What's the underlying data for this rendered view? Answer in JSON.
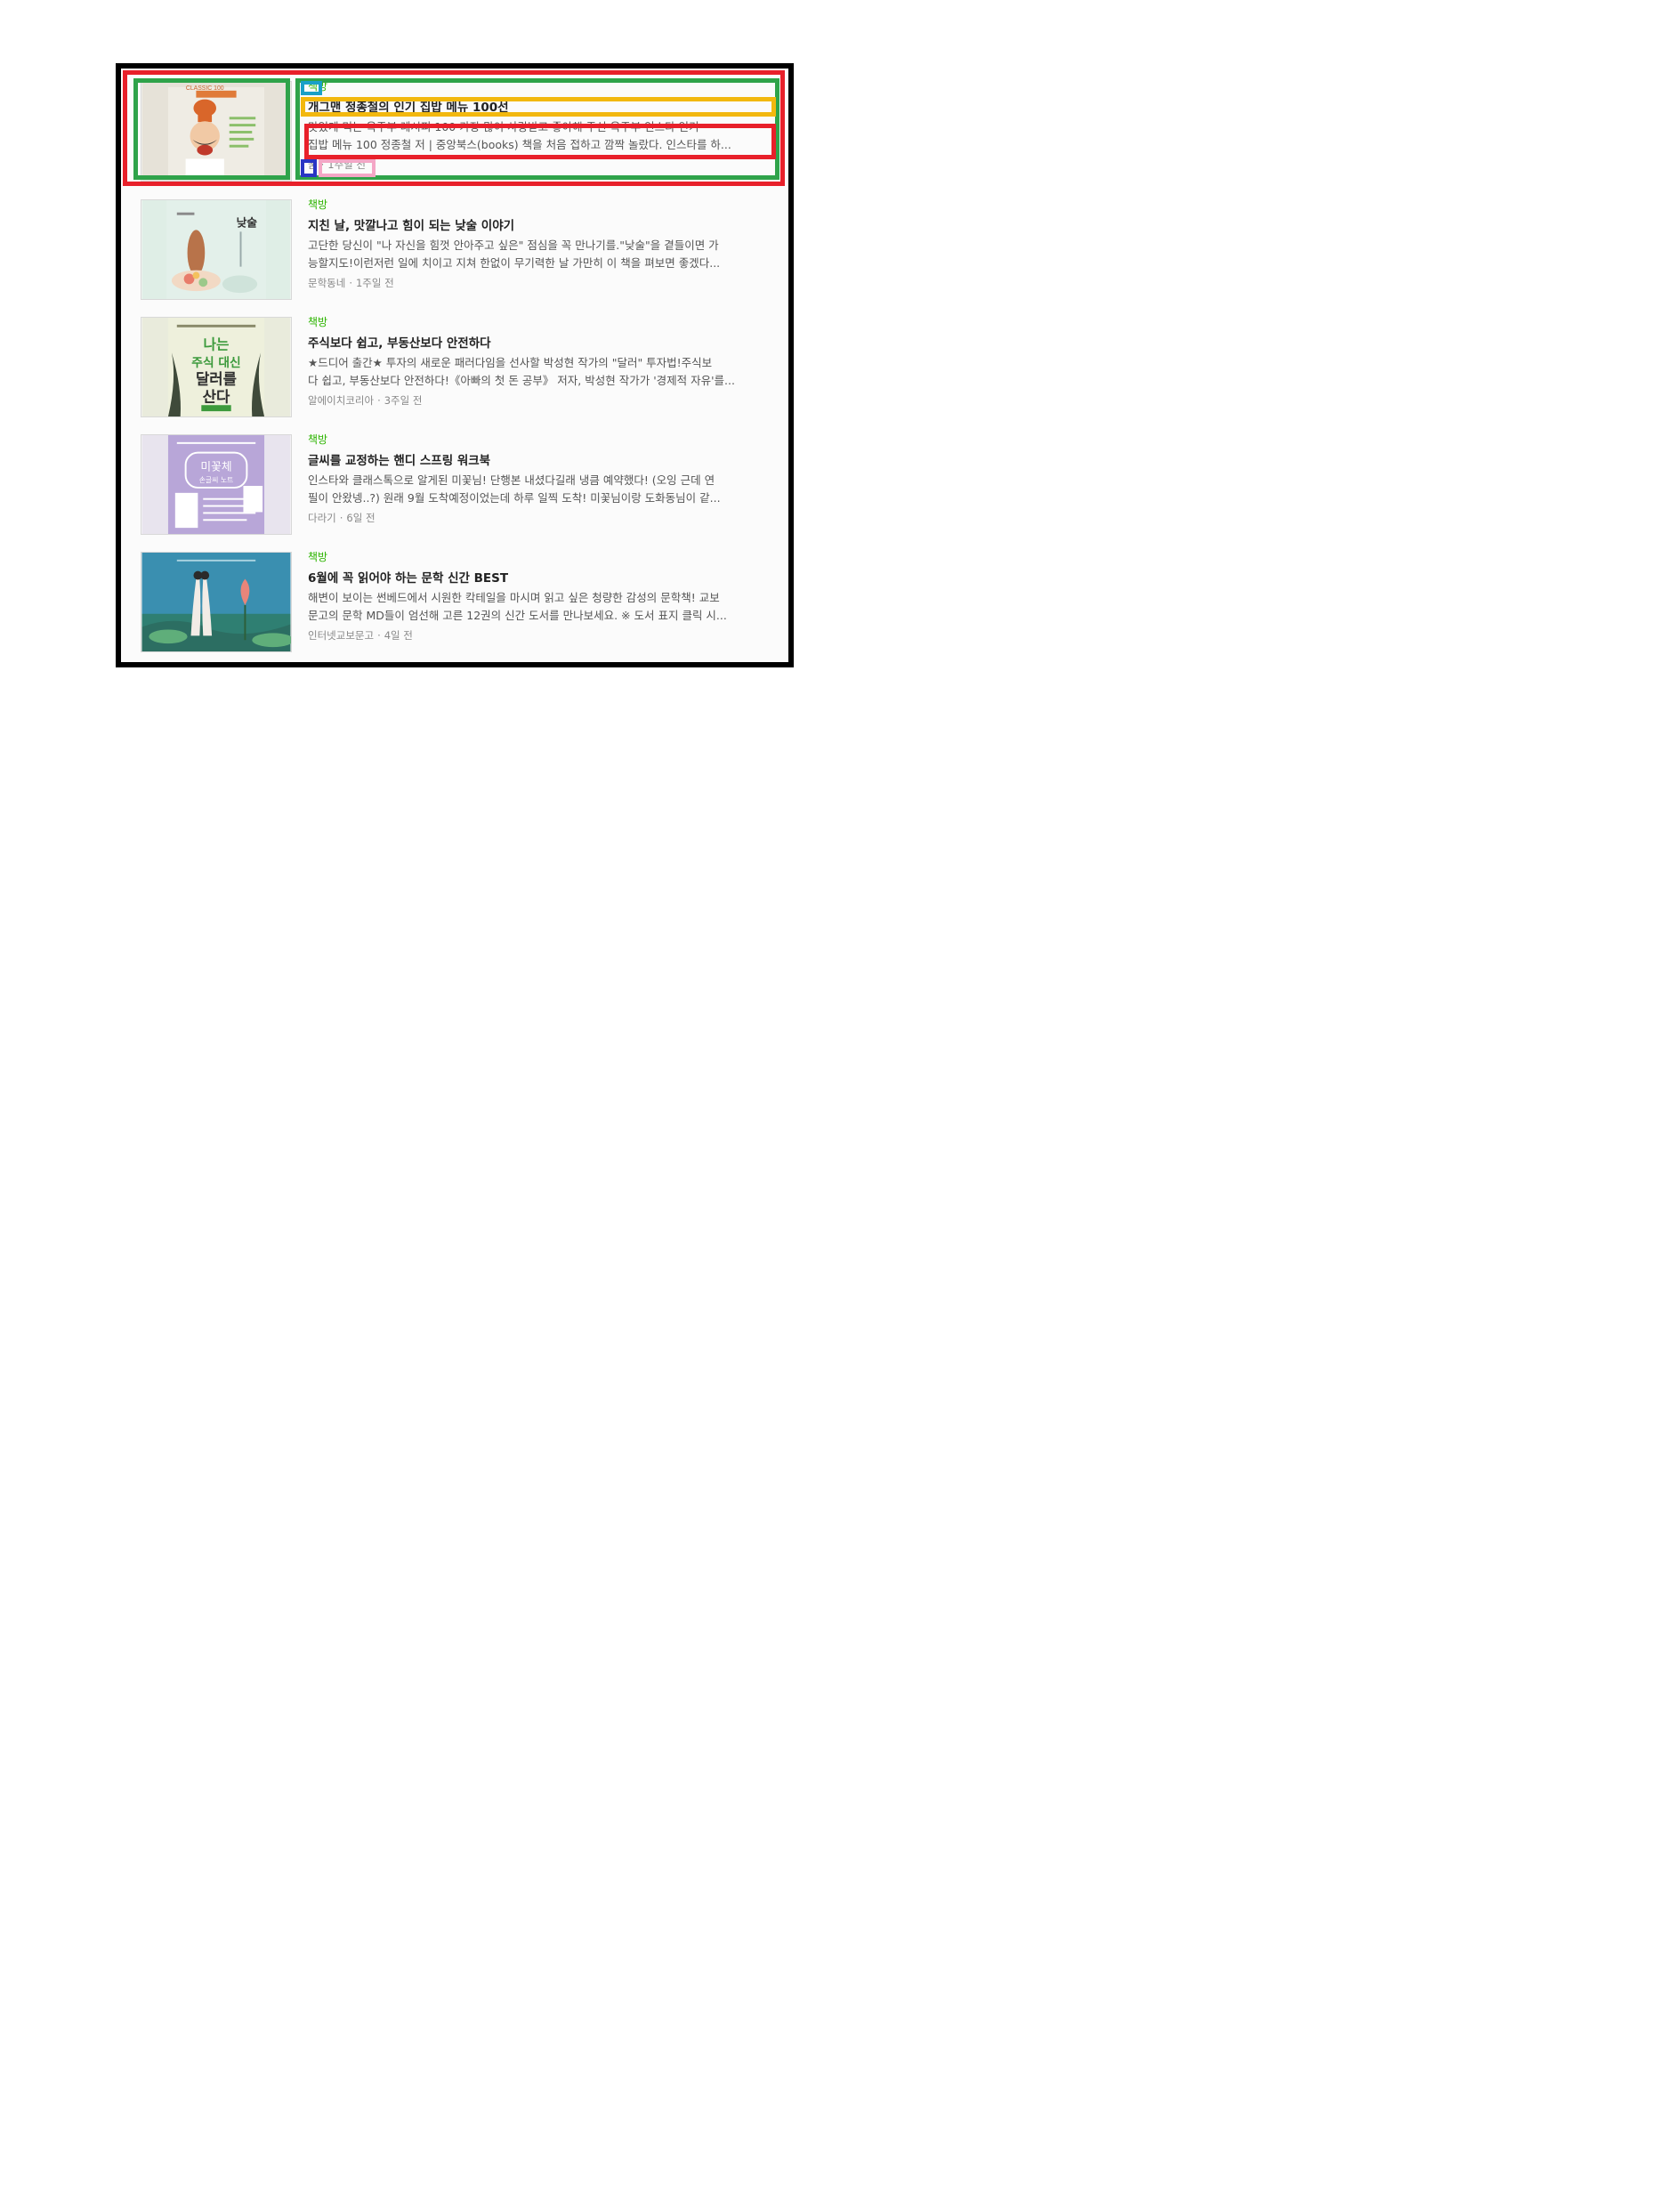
{
  "items": [
    {
      "category": "책방",
      "title": "개그맨 정종철의 인기 집밥 메뉴 100선",
      "desc_line1": "맛있게 먹는 옥주부 레시피 100 가장 많이 사랑받고 좋아해 주신 옥주부 인스타 인기",
      "desc_line2": "집밥 메뉴 100 정종철 저 | 중앙북스(books) 책을 처음 접하고 깜짝 놀랐다. 인스타를 하...",
      "source": "꿈",
      "time": "1주일 전",
      "cover": {
        "bg": "#e6e2d8",
        "label": "CLASSIC 100",
        "accent": "#e07b39"
      }
    },
    {
      "category": "책방",
      "title": "지친 날, 맛깔나고 힘이 되는 낮술 이야기",
      "desc_line1": "고단한 당신이 \"나 자신을 힘껏 안아주고 싶은\" 점심을 꼭 만나기를.\"낮술\"을 곁들이면 가",
      "desc_line2": "능할지도!이런저런 일에 치이고 지쳐 한없이 무기력한 날 가만히 이 책을 펴보면 좋겠다...",
      "source": "문학동네",
      "time": "1주일 전",
      "cover": {
        "bg": "#dfeee6",
        "label": "낮술",
        "accent": "#c98a5a"
      }
    },
    {
      "category": "책방",
      "title": "주식보다 쉽고, 부동산보다 안전하다",
      "desc_line1": "★드디어 출간★ 투자의 새로운 패러다임을 선사할 박성현 작가의 \"달러\" 투자법!주식보",
      "desc_line2": "다 쉽고, 부동산보다 안전하다!《아빠의 첫 돈 공부》 저자, 박성현 작가가 '경제적 자유'를...",
      "source": "알에이치코리아",
      "time": "3주일 전",
      "cover": {
        "bg": "#eef0dc",
        "label1": "나는",
        "label2": "주식 대신",
        "label3": "달러를",
        "label4": "산다",
        "accent": "#3c9a3c"
      }
    },
    {
      "category": "책방",
      "title": "글씨를 교정하는 핸디 스프링 워크북",
      "desc_line1": "인스타와 클래스톡으로 알게된 미꽃님! 단행본 내셨다길래 냉큼 예약했다! (오잉 근데 연",
      "desc_line2": "필이 안왔넹..?) 원래 9월 도착예정이었는데 하루 일찍 도착! 미꽃님이랑 도화동님이 같...",
      "source": "다라기",
      "time": "6일 전",
      "cover": {
        "bg": "#b8a6d8",
        "label1": "미꽃체",
        "label2": "손글씨 노트",
        "accent": "#ffffff"
      }
    },
    {
      "category": "책방",
      "title": "6월에 꼭 읽어야 하는 문학 신간 BEST",
      "desc_line1": "해변이 보이는 썬베드에서 시원한 칵테일을 마시며 읽고 싶은 청량한 감성의 문학책! 교보",
      "desc_line2": "문고의 문학 MD들이 엄선해 고른 12권의 신간 도서를 만나보세요. ※ 도서 표지 클릭 시...",
      "source": "인터넷교보문고",
      "time": "4일 전",
      "cover": {
        "bg": "#3a8fb0",
        "accent": "#e8857a"
      }
    }
  ],
  "separator": "·",
  "colors": {
    "category": "#2db400",
    "title": "#222222",
    "desc": "#555555",
    "meta": "#888888"
  }
}
